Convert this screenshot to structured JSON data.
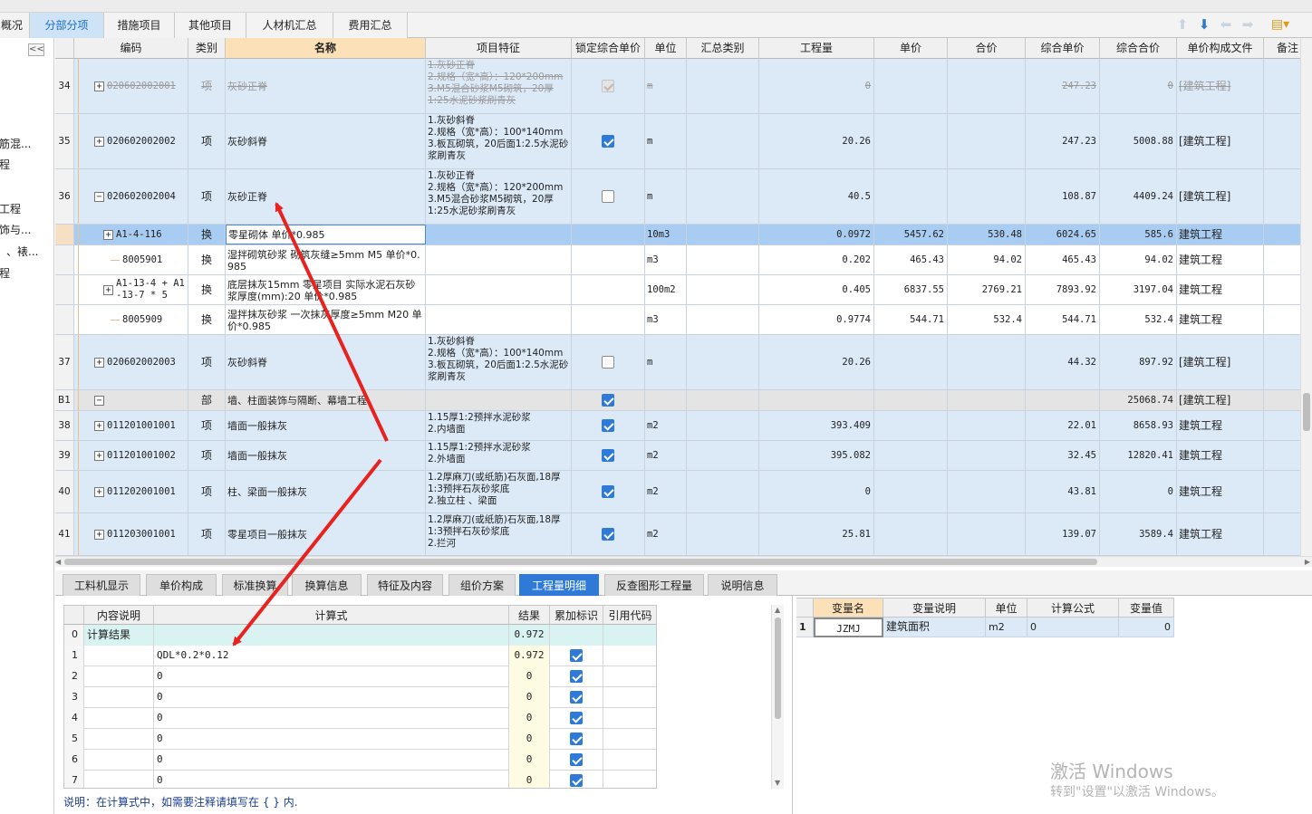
{
  "tabs": [
    {
      "label": "概况",
      "active": false
    },
    {
      "label": "分部分项",
      "active": true
    },
    {
      "label": "措施项目",
      "active": false
    },
    {
      "label": "其他项目",
      "active": false
    },
    {
      "label": "人材机汇总",
      "active": false
    },
    {
      "label": "费用汇总",
      "active": false
    }
  ],
  "toolbar": {
    "up_icon": "arrow-up-icon",
    "down_icon": "arrow-down-icon",
    "left_icon": "arrow-left-icon",
    "right_icon": "arrow-right-icon",
    "settings_icon": "settings-icon"
  },
  "left_panel": {
    "collapse_label": "<<",
    "items": [
      "筋混...",
      "程",
      "工程",
      "饰与...",
      "、裱...",
      "程"
    ]
  },
  "grid": {
    "columns": [
      "编码",
      "类别",
      "名称",
      "项目特征",
      "锁定综合单价",
      "单位",
      "汇总类别",
      "工程量",
      "单价",
      "合价",
      "综合单价",
      "综合合价",
      "单价构成文件",
      "备注"
    ],
    "rows": [
      {
        "idx": "34",
        "code": "020602002001",
        "type": "项",
        "name": "灰砂正脊",
        "feature": "1.灰砂正脊\n2.规格（宽*高）：120*200mm\n3.M5混合砂浆M5砌筑，20厚\n1:25水泥砂浆刷青灰",
        "locked": "disabled",
        "unit": "m",
        "qty": "0",
        "price": "",
        "total": "",
        "cprice": "247.23",
        "ctotal": "0",
        "file": "[建筑工程]",
        "strike": true
      },
      {
        "idx": "35",
        "code": "020602002002",
        "type": "项",
        "name": "灰砂斜脊",
        "feature": "1.灰砂斜脊\n2.规格（宽*高）：100*140mm\n3.板瓦砌筑，20后面1:2.5水泥砂浆刷青灰",
        "locked": "on",
        "unit": "m",
        "qty": "20.26",
        "price": "",
        "total": "",
        "cprice": "247.23",
        "ctotal": "5008.88",
        "file": "[建筑工程]"
      },
      {
        "idx": "36",
        "code": "020602002004",
        "type": "项",
        "name": "灰砂正脊",
        "feature": "1.灰砂正脊\n2.规格（宽*高）：120*200mm\n3.M5混合砂浆M5砌筑，20厚\n1:25水泥砂浆刷青灰",
        "locked": "off",
        "unit": "m",
        "qty": "40.5",
        "price": "",
        "total": "",
        "cprice": "108.87",
        "ctotal": "4409.24",
        "file": "[建筑工程]",
        "expanded": true
      },
      {
        "idx": "",
        "code": "A1-4-116",
        "type": "换",
        "name": "零星砌体  单价*0.985",
        "feature": "",
        "locked": "none",
        "unit": "10m3",
        "qty": "0.0972",
        "price": "5457.62",
        "total": "530.48",
        "cprice": "6024.65",
        "ctotal": "585.6",
        "file": "建筑工程",
        "selected": true,
        "level": 2,
        "pm": "+"
      },
      {
        "idx": "",
        "code": "8005901",
        "type": "换",
        "name": "湿拌砌筑砂浆 砌筑灰缝≥5mm M5  单价*0.985",
        "feature": "",
        "locked": "none",
        "unit": "m3",
        "qty": "0.202",
        "price": "465.43",
        "total": "94.02",
        "cprice": "465.43",
        "ctotal": "94.02",
        "file": "建筑工程",
        "white": true,
        "level": 3
      },
      {
        "idx": "",
        "code": "A1-13-4 + A1-13-7 * 5",
        "type": "换",
        "name": "底层抹灰15mm 零星项目  实际水泥石灰砂浆厚度(mm):20  单价*0.985",
        "feature": "",
        "locked": "none",
        "unit": "100m2",
        "qty": "0.405",
        "price": "6837.55",
        "total": "2769.21",
        "cprice": "7893.92",
        "ctotal": "3197.04",
        "file": "建筑工程",
        "white": true,
        "level": 2,
        "pm": "+"
      },
      {
        "idx": "",
        "code": "8005909",
        "type": "换",
        "name": "湿拌抹灰砂浆 一次抹灰厚度≥5mm M20  单价*0.985",
        "feature": "",
        "locked": "none",
        "unit": "m3",
        "qty": "0.9774",
        "price": "544.71",
        "total": "532.4",
        "cprice": "544.71",
        "ctotal": "532.4",
        "file": "建筑工程",
        "white": true,
        "level": 3
      },
      {
        "idx": "37",
        "code": "020602002003",
        "type": "项",
        "name": "灰砂斜脊",
        "feature": "1.灰砂斜脊\n2.规格（宽*高）：100*140mm\n3.板瓦砌筑，20后面1:2.5水泥砂浆刷青灰",
        "locked": "off",
        "unit": "m",
        "qty": "20.26",
        "price": "",
        "total": "",
        "cprice": "44.32",
        "ctotal": "897.92",
        "file": "[建筑工程]"
      },
      {
        "idx": "B1",
        "code": "",
        "type": "部",
        "name": "墙、柱面装饰与隔断、幕墙工程",
        "feature": "",
        "locked": "on",
        "unit": "",
        "qty": "",
        "price": "",
        "total": "",
        "cprice": "",
        "ctotal": "25068.74",
        "file": "[建筑工程]",
        "section": true,
        "pm": "−"
      },
      {
        "idx": "38",
        "code": "011201001001",
        "type": "项",
        "name": "墙面一般抹灰",
        "feature": "1.15厚1:2预拌水泥砂浆\n2.内墙面",
        "locked": "on",
        "unit": "m2",
        "qty": "393.409",
        "price": "",
        "total": "",
        "cprice": "22.01",
        "ctotal": "8658.93",
        "file": "建筑工程"
      },
      {
        "idx": "39",
        "code": "011201001002",
        "type": "项",
        "name": "墙面一般抹灰",
        "feature": "1.15厚1:2预拌水泥砂浆\n2.外墙面",
        "locked": "on",
        "unit": "m2",
        "qty": "395.082",
        "price": "",
        "total": "",
        "cprice": "32.45",
        "ctotal": "12820.41",
        "file": "建筑工程"
      },
      {
        "idx": "40",
        "code": "011202001001",
        "type": "项",
        "name": "柱、梁面一般抹灰",
        "feature": "1.2厚麻刀(或纸筋)石灰面,18厚1:3预拌石灰砂浆底\n2.独立柱 、梁面",
        "locked": "on",
        "unit": "m2",
        "qty": "0",
        "price": "",
        "total": "",
        "cprice": "43.81",
        "ctotal": "0",
        "file": "建筑工程"
      },
      {
        "idx": "41",
        "code": "011203001001",
        "type": "项",
        "name": "零星项目一般抹灰",
        "feature": "1.2厚麻刀(或纸筋)石灰面,18厚1:3预拌石灰砂浆底\n2.拦河",
        "locked": "on",
        "unit": "m2",
        "qty": "25.81",
        "price": "",
        "total": "",
        "cprice": "139.07",
        "ctotal": "3589.4",
        "file": "建筑工程"
      }
    ]
  },
  "bottom_tabs": [
    {
      "label": "工料机显示",
      "active": false
    },
    {
      "label": "单价构成",
      "active": false
    },
    {
      "label": "标准换算",
      "active": false
    },
    {
      "label": "换算信息",
      "active": false
    },
    {
      "label": "特征及内容",
      "active": false
    },
    {
      "label": "组价方案",
      "active": false
    },
    {
      "label": "工程量明细",
      "active": true
    },
    {
      "label": "反查图形工程量",
      "active": false
    },
    {
      "label": "说明信息",
      "active": false
    }
  ],
  "detail": {
    "columns": [
      "内容说明",
      "计算式",
      "结果",
      "累加标识",
      "引用代码"
    ],
    "rows": [
      {
        "idx": "0",
        "desc": "计算结果",
        "formula": "",
        "result": "0.972",
        "accum": "none",
        "ref": "",
        "summary": true
      },
      {
        "idx": "1",
        "desc": "",
        "formula": "QDL*0.2*0.12",
        "result": "0.972",
        "accum": "on",
        "ref": ""
      },
      {
        "idx": "2",
        "desc": "",
        "formula": "0",
        "result": "0",
        "accum": "on",
        "ref": ""
      },
      {
        "idx": "3",
        "desc": "",
        "formula": "0",
        "result": "0",
        "accum": "on",
        "ref": ""
      },
      {
        "idx": "4",
        "desc": "",
        "formula": "0",
        "result": "0",
        "accum": "on",
        "ref": ""
      },
      {
        "idx": "5",
        "desc": "",
        "formula": "0",
        "result": "0",
        "accum": "on",
        "ref": ""
      },
      {
        "idx": "6",
        "desc": "",
        "formula": "0",
        "result": "0",
        "accum": "on",
        "ref": ""
      },
      {
        "idx": "7",
        "desc": "",
        "formula": "0",
        "result": "0",
        "accum": "on",
        "ref": ""
      }
    ],
    "note": "说明：在计算式中，如需要注释请填写在 { } 内."
  },
  "variables": {
    "columns": [
      "变量名",
      "变量说明",
      "单位",
      "计算公式",
      "变量值"
    ],
    "rows": [
      {
        "idx": "1",
        "name": "JZMJ",
        "desc": "建筑面积",
        "unit": "m2",
        "formula": "0",
        "value": "0"
      }
    ]
  },
  "watermark": {
    "line1": "激活 Windows",
    "line2": "转到\"设置\"以激活 Windows。"
  },
  "colors": {
    "accent": "#2f7ad6",
    "row_blue": "#dceaf8",
    "row_selected": "#a9cdf2",
    "section_gray": "#e4e4e4",
    "header_selected": "#fbe0b8",
    "arrow": "#e8231f"
  }
}
